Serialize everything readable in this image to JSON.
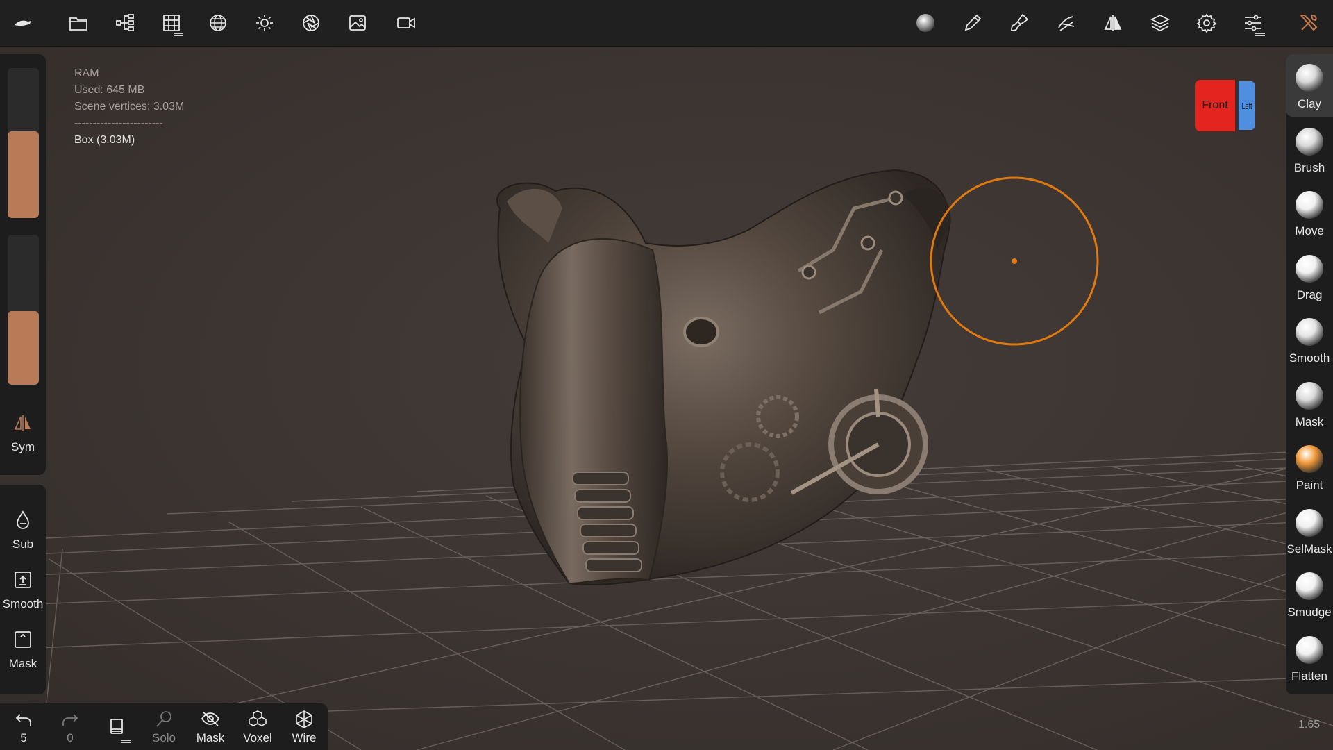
{
  "topbar": {
    "left_icons": [
      "app-logo-icon",
      "folder-icon",
      "scene-tree-icon",
      "topology-grid-icon",
      "sphere-mesh-icon",
      "sun-icon",
      "aperture-icon",
      "image-icon",
      "video-camera-icon"
    ],
    "right_icons": [
      "material-sphere-icon",
      "pencil-icon",
      "paint-brush-icon",
      "stroke-icon",
      "symmetry-icon",
      "layers-icon",
      "settings-icon",
      "sliders-icon",
      "tools-icon"
    ]
  },
  "info": {
    "ram_label": "RAM",
    "used": "Used: 645 MB",
    "vertices": "Scene vertices: 3.03M",
    "separator": "------------------------",
    "object": "Box (3.03M)"
  },
  "left_panel": {
    "radius_slider_level": 0.58,
    "intensity_slider_level": 0.49,
    "sym_label": "Sym",
    "sub_label": "Sub",
    "smooth_label": "Smooth",
    "mask_label": "Mask"
  },
  "viewcube": {
    "front": "Front",
    "left": "Left"
  },
  "tools": [
    {
      "label": "Clay",
      "color": "#d9d9d9",
      "selected": true
    },
    {
      "label": "Brush",
      "color": "#d9d9d9"
    },
    {
      "label": "Move",
      "color": "#f0f0f0"
    },
    {
      "label": "Drag",
      "color": "#f0f0f0"
    },
    {
      "label": "Smooth",
      "color": "#e4e4e4"
    },
    {
      "label": "Mask",
      "color": "#d9d9d9"
    },
    {
      "label": "Paint",
      "color": "#f29a3a"
    },
    {
      "label": "SelMask",
      "color": "#f0f0f0"
    },
    {
      "label": "Smudge",
      "color": "#f0f0f0"
    },
    {
      "label": "Flatten",
      "color": "#f0f0f0"
    }
  ],
  "bottombar": {
    "undo_count": "5",
    "redo_count": "0",
    "solo_label": "Solo",
    "mask_label": "Mask",
    "voxel_label": "Voxel",
    "wire_label": "Wire"
  },
  "zoom": "1.65",
  "colors": {
    "accent": "#b97a58",
    "brush_cursor": "#e07a10",
    "cube_front": "#e3241f",
    "cube_left": "#4f8fe0"
  }
}
